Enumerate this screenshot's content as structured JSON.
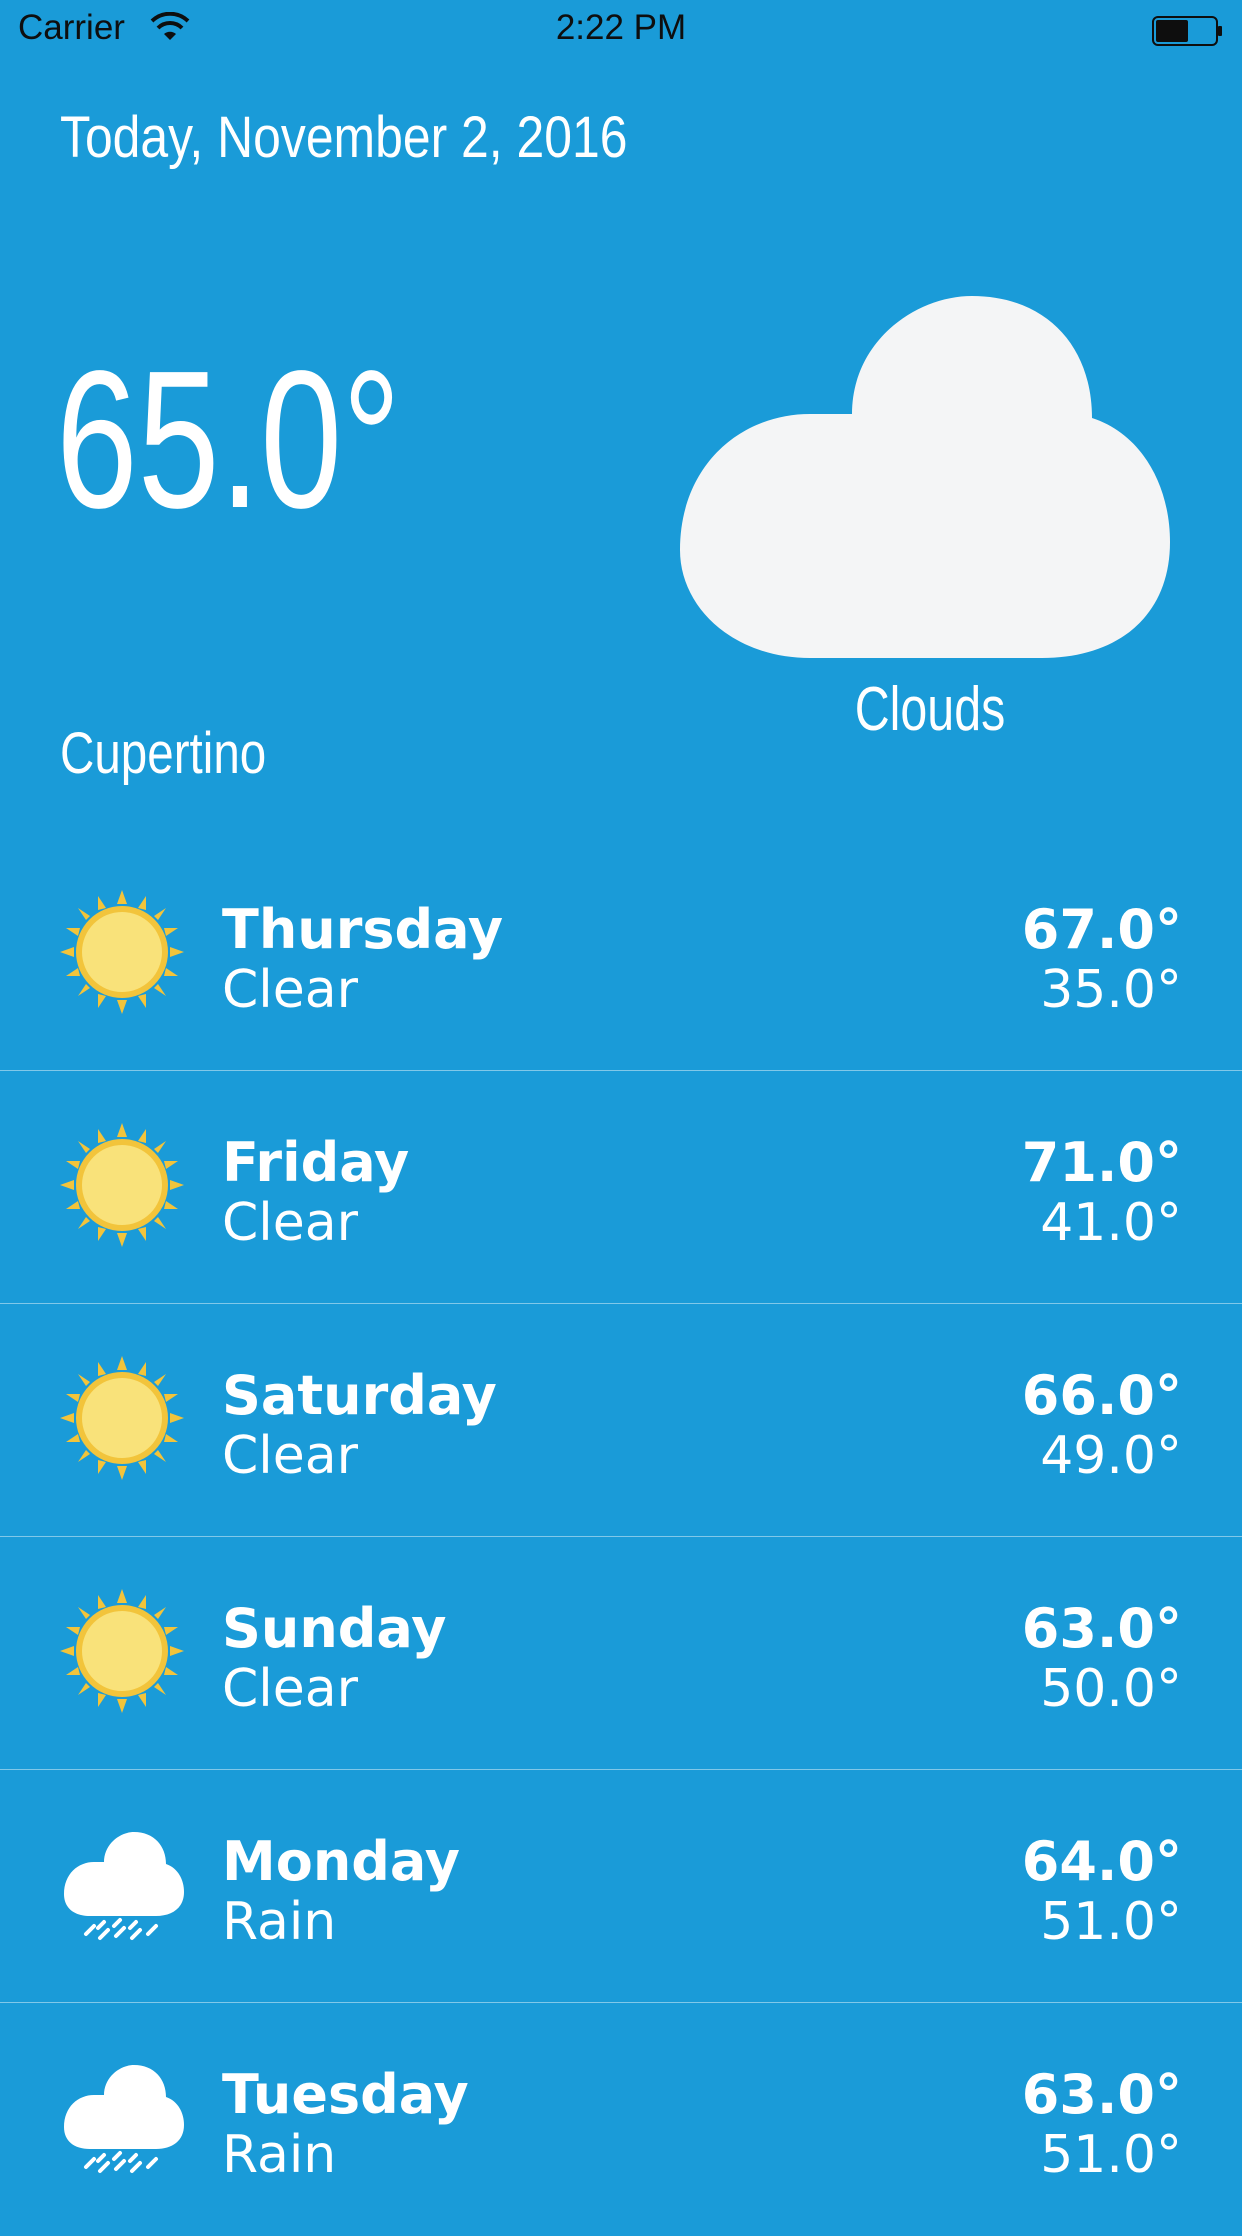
{
  "status_bar": {
    "carrier": "Carrier",
    "time": "2:22 PM",
    "wifi_icon": "wifi-icon",
    "battery_icon": "battery-icon"
  },
  "header": {
    "date": "Today, November 2, 2016",
    "current_temp": "65.0°",
    "city": "Cupertino",
    "condition": "Clouds",
    "condition_icon": "cloud-icon"
  },
  "colors": {
    "background": "#1a9bd8",
    "text": "#ffffff",
    "sun": "#f7d44c",
    "cloud": "#ffffff"
  },
  "forecast": [
    {
      "day": "Thursday",
      "condition": "Clear",
      "high": "67.0°",
      "low": "35.0°",
      "icon": "sun-icon"
    },
    {
      "day": "Friday",
      "condition": "Clear",
      "high": "71.0°",
      "low": "41.0°",
      "icon": "sun-icon"
    },
    {
      "day": "Saturday",
      "condition": "Clear",
      "high": "66.0°",
      "low": "49.0°",
      "icon": "sun-icon"
    },
    {
      "day": "Sunday",
      "condition": "Clear",
      "high": "63.0°",
      "low": "50.0°",
      "icon": "sun-icon"
    },
    {
      "day": "Monday",
      "condition": "Rain",
      "high": "64.0°",
      "low": "51.0°",
      "icon": "rain-icon"
    },
    {
      "day": "Tuesday",
      "condition": "Rain",
      "high": "63.0°",
      "low": "51.0°",
      "icon": "rain-icon"
    }
  ]
}
